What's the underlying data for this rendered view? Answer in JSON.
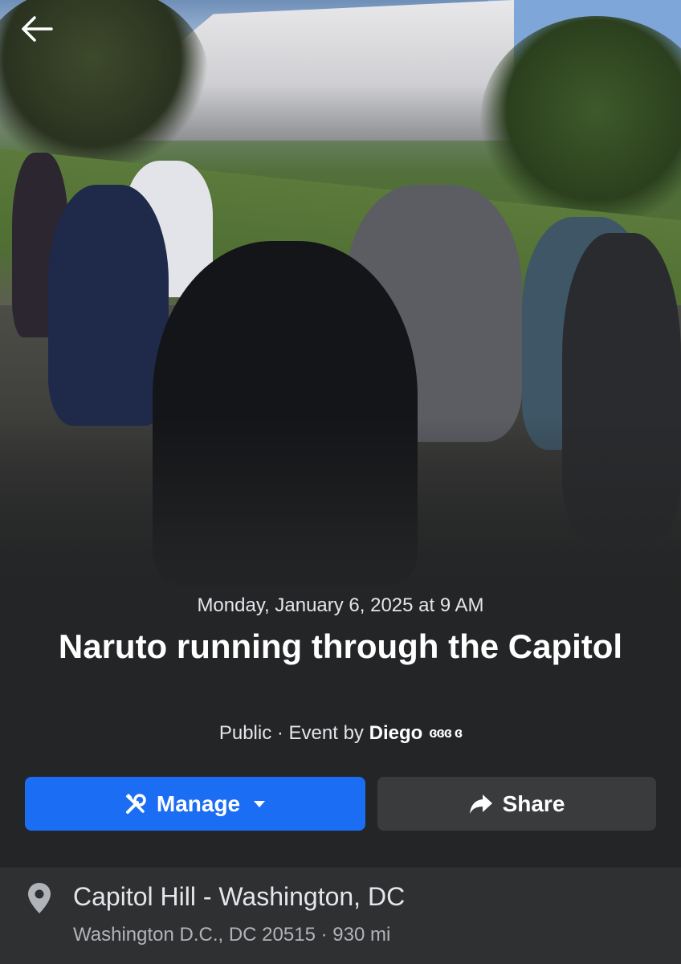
{
  "header": {
    "back_icon": "arrow-left-icon"
  },
  "event": {
    "date": "Monday, January 6, 2025 at 9 AM",
    "title": "Naruto running through the Capitol",
    "privacy": "Public",
    "separator": " · ",
    "by_prefix": "Event by ",
    "host": "Diego",
    "host_surname_obscured": "ɞɞɞ ɞ"
  },
  "actions": {
    "manage_label": "Manage",
    "manage_icon": "tools-icon",
    "manage_caret_icon": "caret-down-icon",
    "share_label": "Share",
    "share_icon": "share-arrow-icon",
    "manage_color": "#1b6ef3",
    "share_color": "#3a3b3c"
  },
  "location": {
    "icon": "map-pin-icon",
    "name": "Capitol Hill - Washington, DC",
    "address": "Washington D.C., DC 20515 · 930 mi"
  }
}
